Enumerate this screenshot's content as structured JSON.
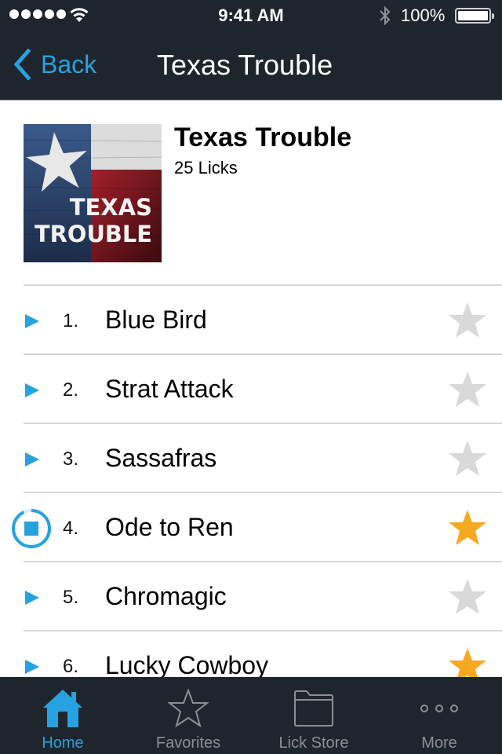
{
  "status_bar": {
    "signal_bars": 5,
    "time": "9:41 AM",
    "battery_percent": "100%",
    "battery_level": 1.0
  },
  "nav": {
    "back_label": "Back",
    "title": "Texas Trouble"
  },
  "album": {
    "cover_text_line1": "TEXAS",
    "cover_text_line2": "TROUBLE",
    "title": "Texas Trouble",
    "count": "25 Licks"
  },
  "colors": {
    "accent": "#27a2e0",
    "favorite": "#f7a823",
    "unfavorite": "#d9d9d9",
    "bar_background": "#1f252d",
    "inactive_tab": "#8b8f94"
  },
  "tracks": [
    {
      "number": "1.",
      "name": "Blue Bird",
      "state": "play",
      "favorite": false
    },
    {
      "number": "2.",
      "name": "Strat Attack",
      "state": "play",
      "favorite": false
    },
    {
      "number": "3.",
      "name": "Sassafras",
      "state": "play",
      "favorite": false
    },
    {
      "number": "4.",
      "name": "Ode to Ren",
      "state": "playing",
      "progress": 0.93,
      "favorite": true
    },
    {
      "number": "5.",
      "name": "Chromagic",
      "state": "play",
      "favorite": false
    },
    {
      "number": "6.",
      "name": "Lucky Cowboy",
      "state": "play",
      "favorite": true
    }
  ],
  "tabs": [
    {
      "label": "Home",
      "icon": "home-icon",
      "active": true
    },
    {
      "label": "Favorites",
      "icon": "star-outline-icon",
      "active": false
    },
    {
      "label": "Lick Store",
      "icon": "folder-icon",
      "active": false
    },
    {
      "label": "More",
      "icon": "more-icon",
      "active": false
    }
  ]
}
